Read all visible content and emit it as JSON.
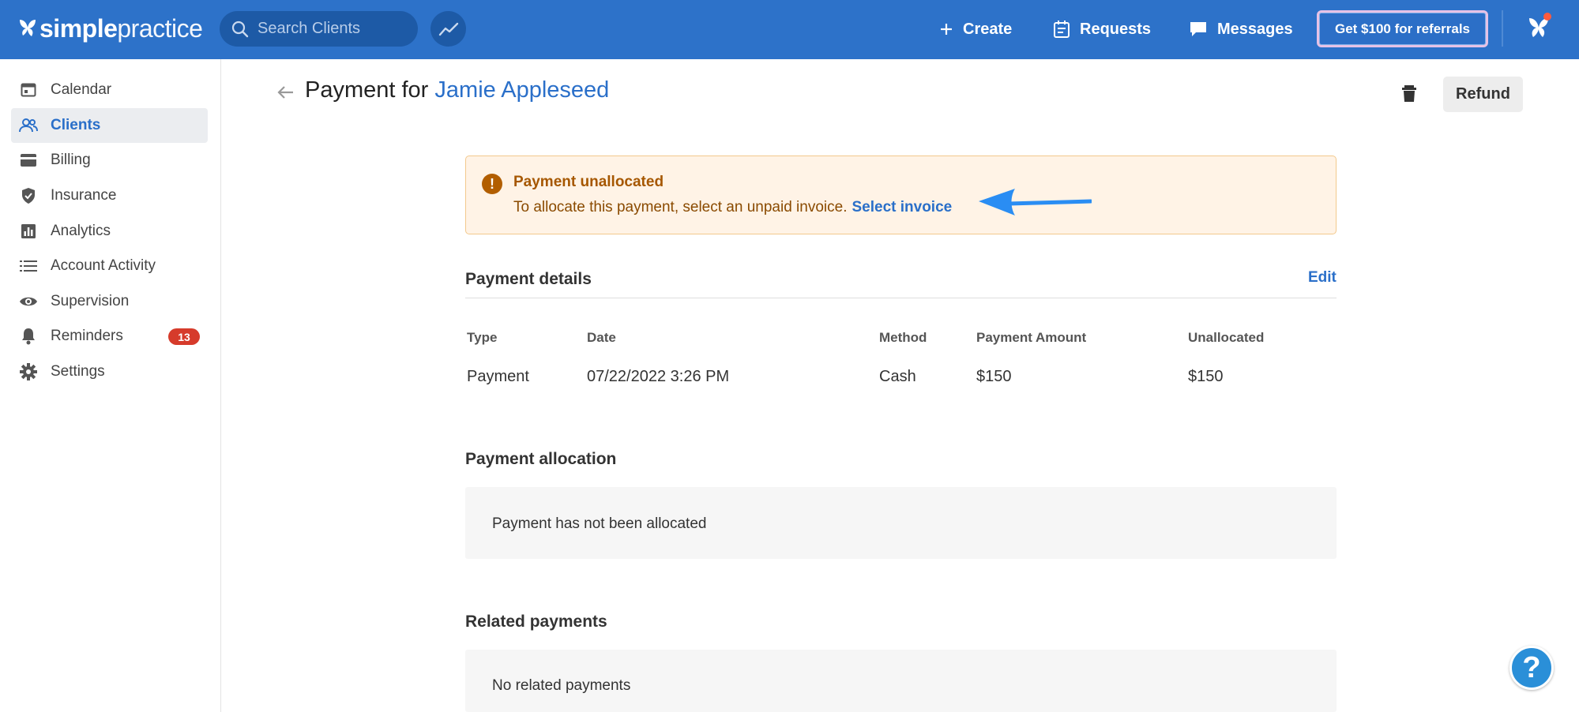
{
  "app": {
    "logo_bold": "simple",
    "logo_light": "practice"
  },
  "topbar": {
    "search_placeholder": "Search Clients",
    "create_label": "Create",
    "requests_label": "Requests",
    "messages_label": "Messages",
    "referral_label": "Get $100 for referrals",
    "brand_color": "#2d72c9"
  },
  "sidebar": {
    "items": [
      {
        "label": "Calendar",
        "icon": "calendar-icon"
      },
      {
        "label": "Clients",
        "icon": "clients-icon",
        "active": true
      },
      {
        "label": "Billing",
        "icon": "billing-icon"
      },
      {
        "label": "Insurance",
        "icon": "shield-icon"
      },
      {
        "label": "Analytics",
        "icon": "analytics-icon"
      },
      {
        "label": "Account Activity",
        "icon": "list-icon"
      },
      {
        "label": "Supervision",
        "icon": "eye-icon"
      },
      {
        "label": "Reminders",
        "icon": "bell-icon",
        "badge": "13"
      },
      {
        "label": "Settings",
        "icon": "gear-icon"
      }
    ]
  },
  "page": {
    "title_prefix": "Payment for",
    "client_name": "Jamie Appleseed",
    "refund_label": "Refund"
  },
  "alert": {
    "title": "Payment unallocated",
    "body": "To allocate this payment, select an unpaid invoice.",
    "link": "Select invoice"
  },
  "payment_details": {
    "title": "Payment details",
    "edit_label": "Edit",
    "columns": [
      "Type",
      "Date",
      "Method",
      "Payment Amount",
      "Unallocated"
    ],
    "row": [
      "Payment",
      "07/22/2022 3:26 PM",
      "Cash",
      "$150",
      "$150"
    ]
  },
  "payment_allocation": {
    "title": "Payment allocation",
    "empty_text": "Payment has not been allocated"
  },
  "related_payments": {
    "title": "Related payments",
    "empty_text": "No related payments"
  },
  "help": {
    "label": "?"
  }
}
